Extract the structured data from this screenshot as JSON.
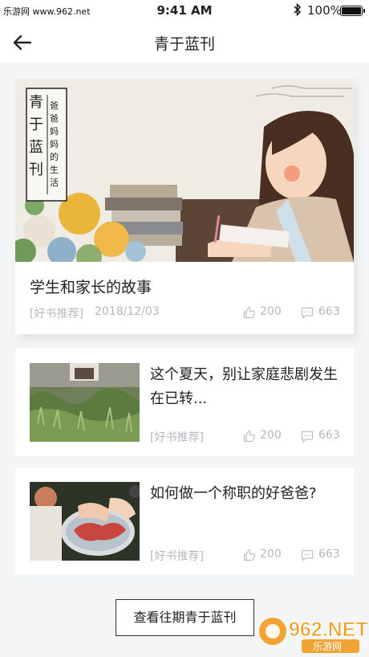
{
  "status_bar": {
    "carrier": "乐游网 www.962.net",
    "time": "9:41 AM",
    "battery": "100%",
    "battery_level": 1.0
  },
  "nav": {
    "title": "青于蓝刊"
  },
  "featured": {
    "title": "学生和家长的故事",
    "tag": "[好书推荐]",
    "date": "2018/12/03",
    "likes": "200",
    "comments": "663",
    "banner_text": {
      "vertical_title": "青于蓝刊",
      "vertical_sub": "爸爸妈妈的生活"
    }
  },
  "articles": [
    {
      "title": "这个夏天，别让家庭悲剧发生在已转...",
      "tag": "[好书推荐]",
      "likes": "200",
      "comments": "663"
    },
    {
      "title": "如何做一个称职的好爸爸?",
      "tag": "[好书推荐]",
      "likes": "200",
      "comments": "663"
    }
  ],
  "archive_button": "查看往期青于蓝刊",
  "watermark": {
    "main": "962.NET",
    "sub": "乐游网"
  },
  "icons": [
    "back-arrow-icon",
    "bluetooth-icon",
    "battery-icon",
    "like-icon",
    "comment-icon"
  ]
}
